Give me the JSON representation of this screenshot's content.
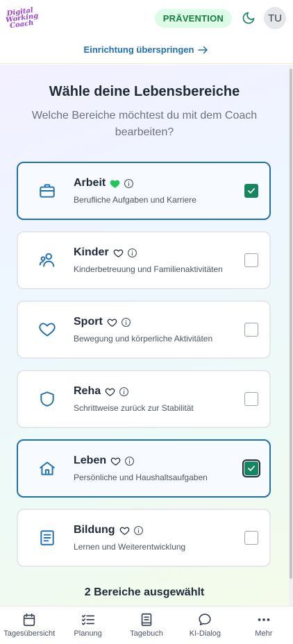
{
  "header": {
    "logo": [
      "Digital",
      "Working",
      "Coach"
    ],
    "badge": "PRÄVENTION",
    "avatar": "TU",
    "skip_link": "Einrichtung überspringen"
  },
  "main": {
    "title": "Wähle deine Lebensbereiche",
    "subtitle": "Welche Bereiche möchtest du mit dem Coach bearbeiten?",
    "areas": [
      {
        "title": "Arbeit",
        "desc": "Berufliche Aufgaben und Karriere",
        "checked": true,
        "favorite": true,
        "icon": "briefcase-icon"
      },
      {
        "title": "Kinder",
        "desc": "Kinderbetreuung und Familienaktivitäten",
        "checked": false,
        "favorite": false,
        "icon": "people-icon"
      },
      {
        "title": "Sport",
        "desc": "Bewegung und körperliche Aktivitäten",
        "checked": false,
        "favorite": false,
        "icon": "heart-icon"
      },
      {
        "title": "Reha",
        "desc": "Schrittweise zurück zur Stabilität",
        "checked": false,
        "favorite": false,
        "icon": "shield-icon"
      },
      {
        "title": "Leben",
        "desc": "Persönliche und Haushaltsaufgaben",
        "checked": true,
        "favorite": false,
        "icon": "home-icon"
      },
      {
        "title": "Bildung",
        "desc": "Lernen und Weiterentwicklung",
        "checked": false,
        "favorite": false,
        "icon": "book-icon"
      }
    ],
    "selected_count": "2 Bereiche ausgewählt"
  },
  "nav": [
    {
      "label": "Tagesübersicht",
      "icon": "calendar-icon"
    },
    {
      "label": "Planung",
      "icon": "checklist-icon"
    },
    {
      "label": "Tagebuch",
      "icon": "journal-icon"
    },
    {
      "label": "KI-Dialog",
      "icon": "chat-icon"
    },
    {
      "label": "Mehr",
      "icon": "more-icon"
    }
  ],
  "colors": {
    "accent": "#1d6fb8",
    "check": "#15875f",
    "badge_bg": "#dcfce7",
    "badge_text": "#15803d",
    "favorite": "#22c55e"
  }
}
